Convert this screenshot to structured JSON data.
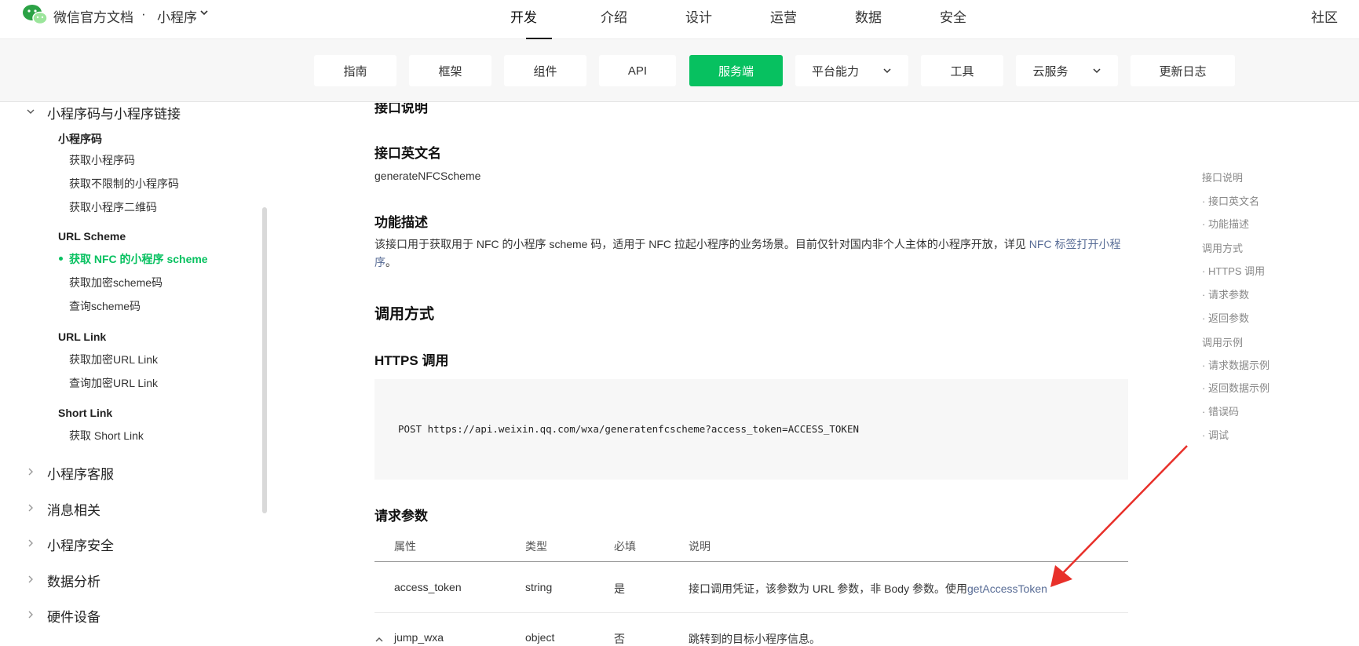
{
  "header": {
    "brand": "微信官方文档",
    "separator": "·",
    "product": "小程序",
    "nav": [
      "开发",
      "介绍",
      "设计",
      "运营",
      "数据",
      "安全"
    ],
    "active_nav": "开发",
    "community": "社区"
  },
  "subnav": {
    "items": [
      "指南",
      "框架",
      "组件",
      "API",
      "服务端",
      "平台能力",
      "工具",
      "云服务",
      "更新日志"
    ],
    "active": "服务端",
    "accent_color": "#07c160"
  },
  "sidebar": {
    "group_open": "小程序码与小程序链接",
    "sections": [
      {
        "title": "小程序码",
        "links": [
          "获取小程序码",
          "获取不限制的小程序码",
          "获取小程序二维码"
        ]
      },
      {
        "title": "URL Scheme",
        "links": [
          "获取 NFC 的小程序 scheme",
          "获取加密scheme码",
          "查询scheme码"
        ]
      },
      {
        "title": "URL Link",
        "links": [
          "获取加密URL Link",
          "查询加密URL Link"
        ]
      },
      {
        "title": "Short Link",
        "links": [
          "获取 Short Link"
        ]
      }
    ],
    "active_link": "获取 NFC 的小程序 scheme",
    "collapsed_groups": [
      "小程序客服",
      "消息相关",
      "小程序安全",
      "数据分析",
      "硬件设备"
    ]
  },
  "main": {
    "cut_heading": "接口说明",
    "en_name_heading": "接口英文名",
    "en_name": "generateNFCScheme",
    "desc_heading": "功能描述",
    "desc_text": "该接口用于获取用于 NFC 的小程序 scheme 码，适用于 NFC 拉起小程序的业务场景。目前仅针对国内非个人主体的小程序开放，详见 ",
    "desc_link": "NFC 标签打开小程",
    "desc_link_tail": "序",
    "desc_end": "。",
    "call_heading": "调用方式",
    "https_heading": "HTTPS 调用",
    "code": "POST https://api.weixin.qq.com/wxa/generatenfcscheme?access_token=ACCESS_TOKEN",
    "params_heading": "请求参数",
    "table": {
      "headers": [
        "属性",
        "类型",
        "必填",
        "说明"
      ],
      "rows": [
        {
          "name": "access_token",
          "type": "string",
          "required": "是",
          "desc": "接口调用凭证，该参数为 URL 参数，非 Body 参数。使用",
          "desc_link": "getAccessToken"
        },
        {
          "name": "jump_wxa",
          "type": "object",
          "required": "否",
          "desc": "跳转到的目标小程序信息。",
          "desc_link": ""
        }
      ]
    }
  },
  "toc": {
    "items": [
      {
        "label": "接口说明",
        "sub": false
      },
      {
        "label": "· 接口英文名",
        "sub": true
      },
      {
        "label": "· 功能描述",
        "sub": true
      },
      {
        "label": "调用方式",
        "sub": false
      },
      {
        "label": "· HTTPS 调用",
        "sub": true
      },
      {
        "label": "· 请求参数",
        "sub": true
      },
      {
        "label": "· 返回参数",
        "sub": true
      },
      {
        "label": "调用示例",
        "sub": false
      },
      {
        "label": "· 请求数据示例",
        "sub": true
      },
      {
        "label": "· 返回数据示例",
        "sub": true
      },
      {
        "label": "· 错误码",
        "sub": true
      },
      {
        "label": "· 调试",
        "sub": true
      }
    ]
  },
  "annotation": {
    "color": "#e8302a"
  }
}
